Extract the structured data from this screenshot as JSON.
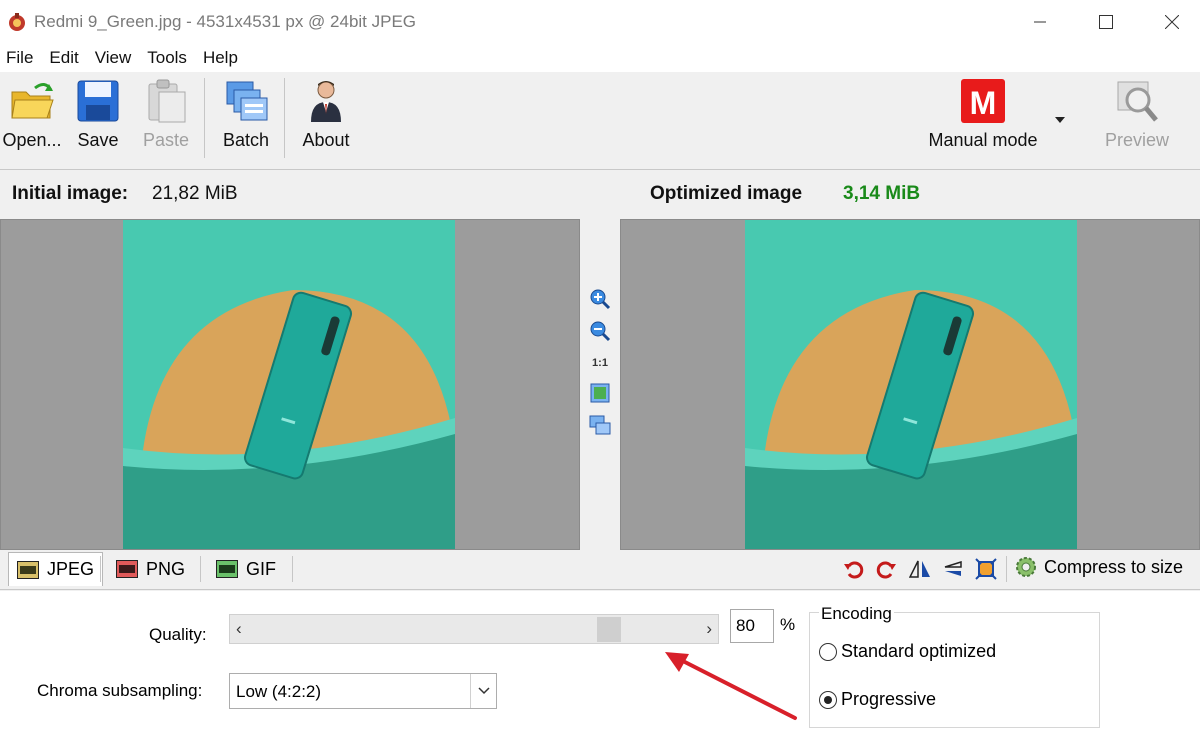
{
  "window": {
    "title": "Redmi 9_Green.jpg - 4531x4531 px @ 24bit JPEG"
  },
  "menu": [
    "File",
    "Edit",
    "View",
    "Tools",
    "Help"
  ],
  "toolbar": {
    "open": "Open...",
    "save": "Save",
    "paste": "Paste",
    "batch": "Batch",
    "about": "About",
    "mode_letter": "M",
    "mode": "Manual mode",
    "preview": "Preview"
  },
  "sizes": {
    "initial_label": "Initial image:",
    "initial_value": "21,82 MiB",
    "optimized_label": "Optimized image",
    "optimized_value": "3,14 MiB"
  },
  "zoom": {
    "one_to_one": "1:1"
  },
  "tabs": [
    {
      "label": "JPEG",
      "active": true
    },
    {
      "label": "PNG",
      "active": false
    },
    {
      "label": "GIF",
      "active": false
    }
  ],
  "tools": {
    "compress_to_size": "Compress to size"
  },
  "settings": {
    "quality_label": "Quality:",
    "quality_value": "80",
    "quality_fraction": 0.8,
    "quality_unit": "%",
    "chroma_label": "Chroma subsampling:",
    "chroma_value": "Low (4:2:2)",
    "encoding_title": "Encoding",
    "encoding_options": [
      {
        "label": "Standard optimized",
        "selected": false
      },
      {
        "label": "Progressive",
        "selected": true
      }
    ]
  },
  "colors": {
    "accent_red": "#e81b1b",
    "optimized_green": "#1a8a1a",
    "annotation_arrow": "#d8202a"
  }
}
